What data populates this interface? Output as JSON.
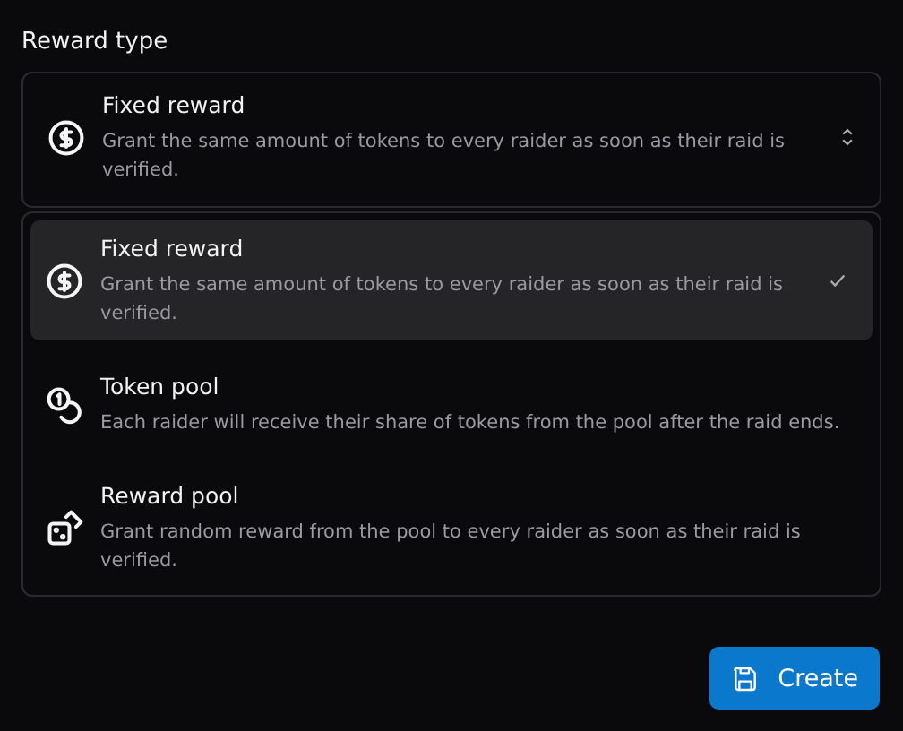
{
  "field": {
    "label": "Reward type",
    "value": {
      "kind": "dollar",
      "title": "Fixed reward",
      "description": "Grant the same amount of tokens to every raider as soon as their raid is verified."
    }
  },
  "dropdown": {
    "options": [
      {
        "kind": "dollar",
        "title": "Fixed reward",
        "description": "Grant the same amount of tokens to every raider as soon as their raid is verified.",
        "selected": true
      },
      {
        "kind": "coins",
        "title": "Token pool",
        "description": "Each raider will receive their share of tokens from the pool after the raid ends.",
        "selected": false
      },
      {
        "kind": "dice",
        "title": "Reward pool",
        "description": "Grant random reward from the pool to every raider as soon as their raid is verified.",
        "selected": false
      }
    ]
  },
  "button": {
    "label": "Create"
  }
}
